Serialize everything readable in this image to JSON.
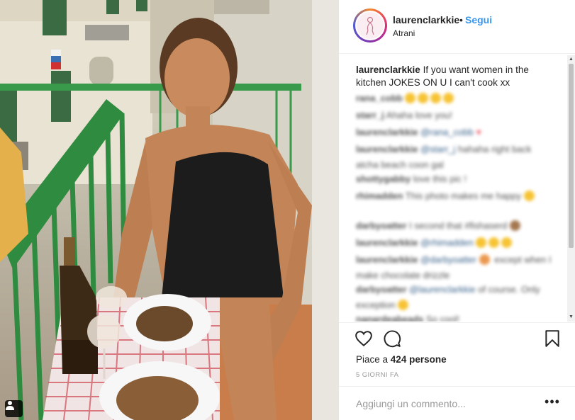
{
  "post": {
    "username": "laurenclarkkie",
    "follow_label": "Segui",
    "separator": "•",
    "location": "Atrani",
    "caption_user": "laurenclarkkie",
    "caption_text": "If you want women in the kitchen JOKES ON U I can't cook xx"
  },
  "comments": [
    {
      "user": "rana_cobb",
      "mention": "",
      "text": ""
    },
    {
      "user": "starr_j",
      "mention": "",
      "text": "Ahaha love you!"
    },
    {
      "user": "laurenclarkkie",
      "mention": "@rana_cobb",
      "text": ""
    },
    {
      "user": "laurenclarkkie",
      "mention": "@starr_j",
      "text": "hahaha right back atcha beach coon gal"
    },
    {
      "user": "shottygabby",
      "mention": "",
      "text": "love this pic !"
    },
    {
      "user": "rhimadden",
      "mention": "",
      "text": "This photo makes me happy"
    },
    {
      "user": "darbyoatter",
      "mention": "",
      "text": "I second that #fishaserd"
    },
    {
      "user": "laurenclarkkie",
      "mention": "@rhimadden",
      "text": ""
    },
    {
      "user": "laurenclarkkie",
      "mention": "@darbyoatter",
      "text": "except when I make chocolate drizzle"
    },
    {
      "user": "darbyoatter",
      "mention": "@laurenclarkkie",
      "text": "of course. Only exception"
    },
    {
      "user": "nanardeabeads",
      "mention": "",
      "text": "So cool!"
    }
  ],
  "actions": {
    "likes_prefix": "Piace a",
    "likes_count": "424 persone",
    "date": "5 GIORNI FA"
  },
  "add_comment": {
    "placeholder": "Aggiungi un commento...",
    "more_label": "•••"
  },
  "icons": {
    "like": "heart-outline-icon",
    "comment": "comment-bubble-icon",
    "save": "bookmark-icon",
    "user_tag": "person-icon",
    "more": "ellipsis-icon"
  },
  "colors": {
    "link_blue": "#3897f0",
    "text": "#262626",
    "muted": "#999999",
    "border": "#efefef"
  }
}
